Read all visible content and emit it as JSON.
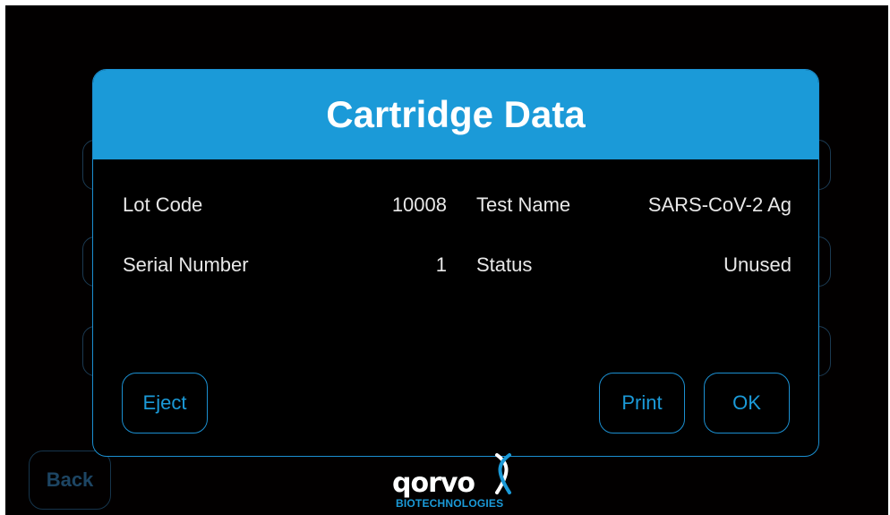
{
  "dialog": {
    "title": "Cartridge Data",
    "fields": {
      "lot_code_label": "Lot Code",
      "lot_code_value": "10008",
      "test_name_label": "Test Name",
      "test_name_value": "SARS-CoV-2 Ag",
      "serial_number_label": "Serial Number",
      "serial_number_value": "1",
      "status_label": "Status",
      "status_value": "Unused"
    },
    "buttons": {
      "eject": "Eject",
      "print": "Print",
      "ok": "OK"
    }
  },
  "background": {
    "back_label": "Back"
  },
  "brand": {
    "name": "qorvo",
    "subtitle": "BIOTECHNOLOGIES",
    "icon": "dna-helix-icon"
  },
  "colors": {
    "accent": "#1b9ad8",
    "background": "#000000",
    "text": "#e8e8e8"
  }
}
